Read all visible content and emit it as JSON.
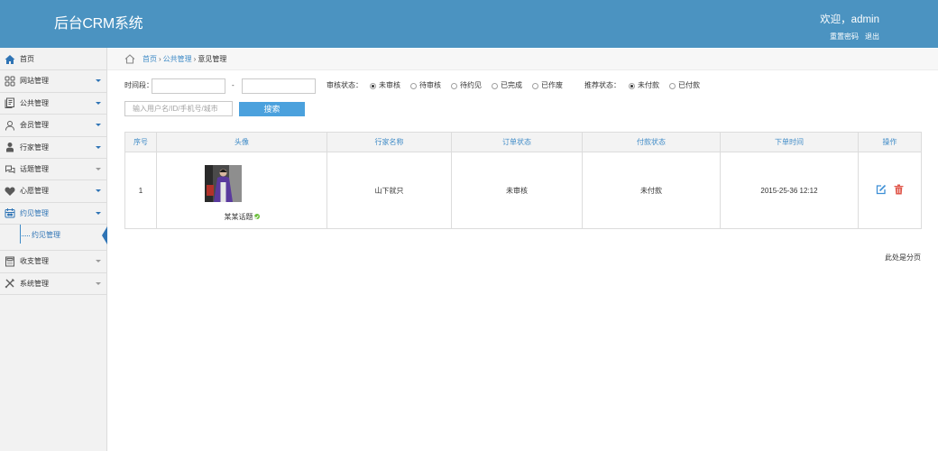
{
  "header": {
    "title": "后台CRM系统",
    "welcome": "欢迎，admin",
    "reset_password": "重置密码",
    "logout": "退出"
  },
  "sidebar": {
    "items": [
      {
        "label": "首页",
        "icon": "home-icon"
      },
      {
        "label": "网站管理",
        "icon": "grid-icon"
      },
      {
        "label": "公共管理",
        "icon": "document-icon"
      },
      {
        "label": "会员管理",
        "icon": "user-icon"
      },
      {
        "label": "行家管理",
        "icon": "expert-icon"
      },
      {
        "label": "话题管理",
        "icon": "chat-icon"
      },
      {
        "label": "心愿管理",
        "icon": "heart-icon"
      },
      {
        "label": "约见管理",
        "icon": "appointment-icon",
        "expanded": true,
        "children": [
          {
            "label": "约见管理",
            "active": true
          }
        ]
      },
      {
        "label": "收支管理",
        "icon": "calculator-icon"
      },
      {
        "label": "系统管理",
        "icon": "tools-icon"
      }
    ]
  },
  "breadcrumb": {
    "items": [
      "首页",
      "公共管理",
      "意见管理"
    ],
    "separator": "›"
  },
  "filters": {
    "time_label": "时间段：",
    "date_separator": "-",
    "audit_label": "审核状态：",
    "audit_options": [
      {
        "label": "未审核",
        "checked": true
      },
      {
        "label": "待审核",
        "checked": false
      },
      {
        "label": "待约见",
        "checked": false
      },
      {
        "label": "已完成",
        "checked": false
      },
      {
        "label": "已作废",
        "checked": false
      }
    ],
    "recommend_label": "推荐状态：",
    "recommend_options": [
      {
        "label": "未付款",
        "checked": true
      },
      {
        "label": "已付款",
        "checked": false
      }
    ],
    "search_placeholder": "输入用户名/ID/手机号/城市",
    "search_button": "搜索"
  },
  "table": {
    "columns": [
      "序号",
      "头像",
      "行家名称",
      "订单状态",
      "付款状态",
      "下单时间",
      "操作"
    ],
    "rows": [
      {
        "index": "1",
        "avatar_caption": "某某话题",
        "expert_name": "山下就只",
        "order_status": "未审核",
        "payment_status": "未付款",
        "order_time": "2015-25-36 12:12",
        "actions": [
          "edit-icon",
          "delete-icon"
        ]
      }
    ]
  },
  "pagination": {
    "text": "此处是分页"
  },
  "colors": {
    "header_bg": "#4b93c1",
    "accent": "#3f8bc7",
    "nav_active": "#2f74b5",
    "button_bg": "#4ba1dd",
    "edit": "#3d8fd6",
    "delete": "#e0584c",
    "badge": "#6cbf3c"
  }
}
